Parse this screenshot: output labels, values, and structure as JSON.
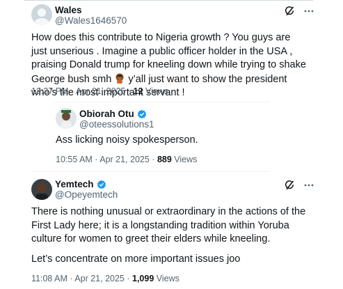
{
  "tweets": [
    {
      "name": "Wales",
      "handle": "@Wales1646570",
      "verified": false,
      "text_before_emoji": "How does this contribute to Nigeria growth ? You guys are just unserious . Imagine a public officer holder in the USA , praising Donald trump for kneeling down while trying to shake George bush smh ",
      "text_after_emoji": " y’all just want to show the president who’s the most important servant !",
      "emoji": "person-facepalming-emoji",
      "time": "12:37 PM · Apr 21, 2025 · ",
      "views_count": "12",
      "views_label": " Views"
    },
    {
      "name": "Obiorah Otu",
      "handle": "@oteessolutions1",
      "verified": true,
      "text": "Ass licking noisy spokesperson.",
      "time": "10:55 AM · Apr 21, 2025 · ",
      "views_count": "889",
      "views_label": " Views"
    },
    {
      "name": "Yemtech",
      "handle": "@Opeyemtech",
      "verified": true,
      "text": "There is nothing unusual or extraordinary in the actions of the First Lady here; it is a longstanding tradition within Yoruba culture for women to greet their elders while kneeling.",
      "text2": "Let’s concentrate on more important issues joo",
      "time": "11:08 AM · Apr 21, 2025 · ",
      "views_count": "1,099",
      "views_label": " Views"
    }
  ],
  "colors": {
    "text": "#0f1419",
    "secondary": "#536471",
    "verified": "#1d9bf0",
    "divider": "#eff3f4"
  },
  "icons": [
    "verified-badge-icon",
    "grok-icon",
    "more-icon",
    "default-avatar-icon"
  ]
}
